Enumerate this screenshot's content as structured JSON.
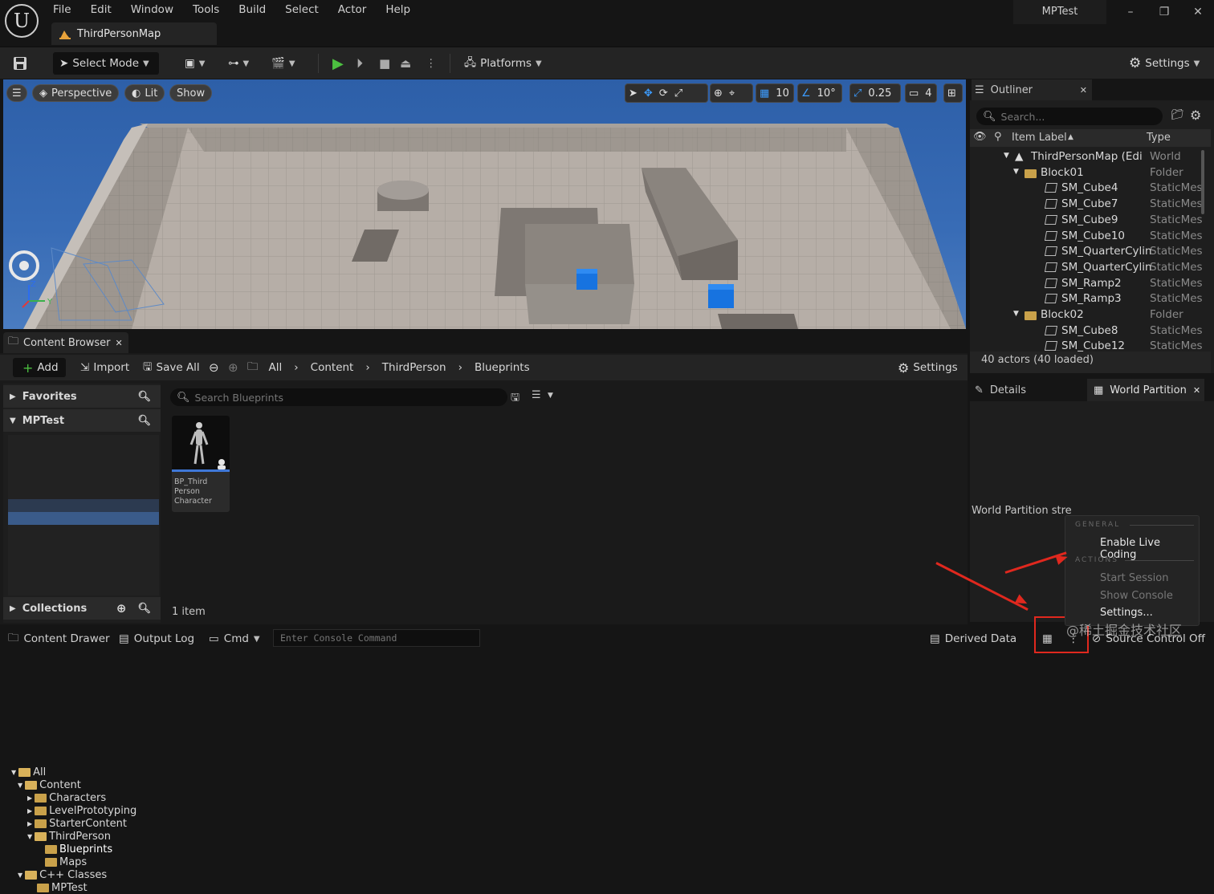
{
  "menu": [
    "File",
    "Edit",
    "Window",
    "Tools",
    "Build",
    "Select",
    "Actor",
    "Help"
  ],
  "map_tab": "ThirdPersonMap",
  "project_name": "MPTest",
  "toolbar": {
    "select_mode": "Select Mode",
    "platforms": "Platforms",
    "settings": "Settings"
  },
  "viewport": {
    "perspective": "Perspective",
    "lit": "Lit",
    "show": "Show",
    "grid_snap": "10",
    "rot_snap": "10°",
    "scale_snap": "0.25",
    "camera_speed": "4",
    "axis_z": "Z",
    "axis_y": "Y"
  },
  "content_browser": {
    "tab": "Content Browser",
    "add": "Add",
    "import": "Import",
    "save_all": "Save All",
    "breadcrumb": [
      "All",
      "Content",
      "ThirdPerson",
      "Blueprints"
    ],
    "settings": "Settings",
    "favorites": "Favorites",
    "project": "MPTest",
    "collections": "Collections",
    "tree": [
      "All",
      "Content",
      "Characters",
      "LevelPrototyping",
      "StarterContent",
      "ThirdPerson",
      "Blueprints",
      "Maps",
      "C++ Classes",
      "MPTest"
    ],
    "search_placeholder": "Search Blueprints",
    "asset_label": "BP_Third Person Character",
    "item_count": "1 item"
  },
  "outliner": {
    "tab": "Outliner",
    "search_placeholder": "Search...",
    "col_label": "Item Label",
    "col_type": "Type",
    "rows": [
      {
        "label": "ThirdPersonMap (Edi",
        "type": "World"
      },
      {
        "label": "Block01",
        "type": "Folder"
      },
      {
        "label": "SM_Cube4",
        "type": "StaticMes"
      },
      {
        "label": "SM_Cube7",
        "type": "StaticMes"
      },
      {
        "label": "SM_Cube9",
        "type": "StaticMes"
      },
      {
        "label": "SM_Cube10",
        "type": "StaticMes"
      },
      {
        "label": "SM_QuarterCylin",
        "type": "StaticMes"
      },
      {
        "label": "SM_QuarterCylin",
        "type": "StaticMes"
      },
      {
        "label": "SM_Ramp2",
        "type": "StaticMes"
      },
      {
        "label": "SM_Ramp3",
        "type": "StaticMes"
      },
      {
        "label": "Block02",
        "type": "Folder"
      },
      {
        "label": "SM_Cube8",
        "type": "StaticMes"
      },
      {
        "label": "SM_Cube12",
        "type": "StaticMes"
      }
    ],
    "actor_count": "40 actors (40 loaded)"
  },
  "details": {
    "tab_details": "Details",
    "tab_world_partition": "World Partition",
    "message": "World Partition stre"
  },
  "popup": {
    "section_general": "GENERAL",
    "enable_live_coding": "Enable Live Coding",
    "section_actions": "ACTIONS",
    "start_session": "Start Session",
    "show_console": "Show Console",
    "settings": "Settings..."
  },
  "statusbar": {
    "content_drawer": "Content Drawer",
    "output_log": "Output Log",
    "cmd": "Cmd",
    "console_placeholder": "Enter Console Command",
    "derived_data": "Derived Data",
    "source_control": "Source Control Off"
  },
  "watermark": "@稀土掘金技术社区"
}
